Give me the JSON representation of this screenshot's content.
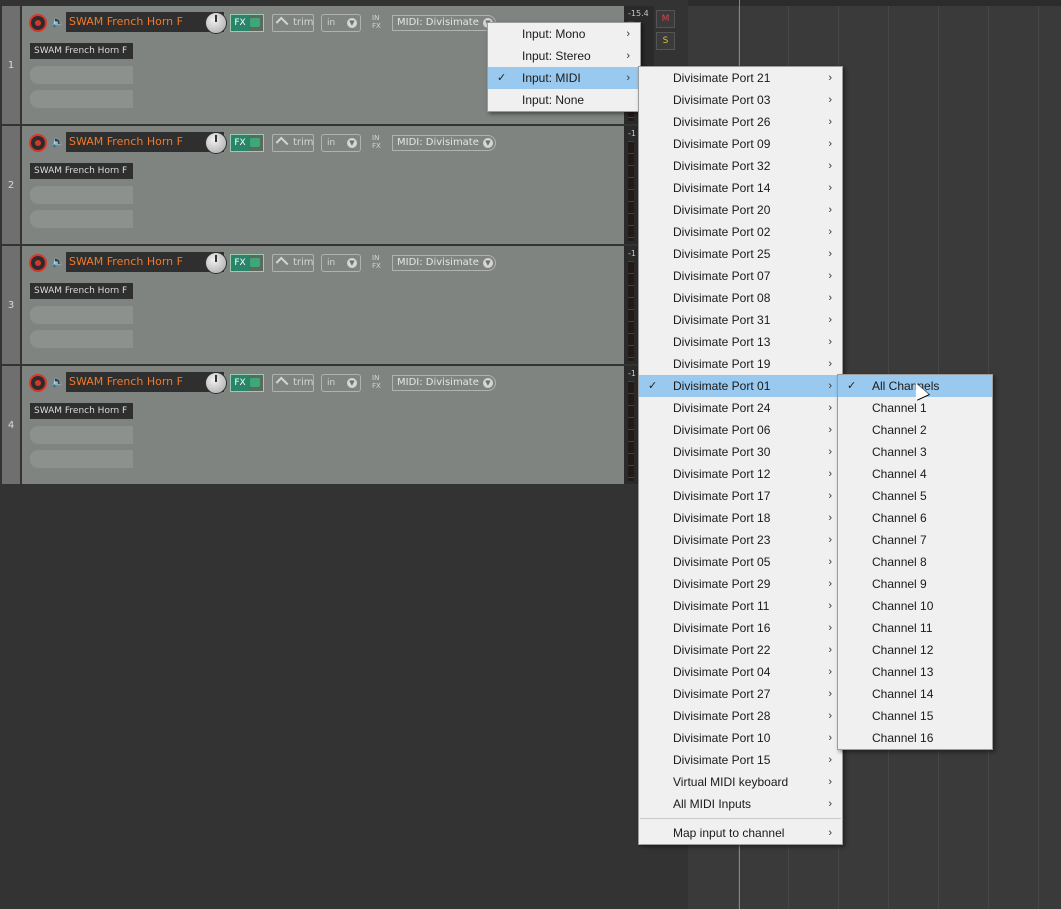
{
  "tracks": [
    {
      "number": "1",
      "name": "SWAM French Horn F",
      "fx": "FX",
      "trim": "trim",
      "input_mode": "in",
      "input_label": "MIDI: Divisimate",
      "item": "SWAM French Horn F",
      "meter": "-15.4"
    },
    {
      "number": "2",
      "name": "SWAM French Horn F",
      "fx": "FX",
      "trim": "trim",
      "input_mode": "in",
      "input_label": "MIDI: Divisimate",
      "item": "SWAM French Horn F",
      "meter": "-1"
    },
    {
      "number": "3",
      "name": "SWAM French Horn F",
      "fx": "FX",
      "trim": "trim",
      "input_mode": "in",
      "input_label": "MIDI: Divisimate",
      "item": "SWAM French Horn F",
      "meter": "-1"
    },
    {
      "number": "4",
      "name": "SWAM French Horn F",
      "fx": "FX",
      "trim": "trim",
      "input_mode": "in",
      "input_label": "MIDI: Divisimate",
      "item": "SWAM French Horn F",
      "meter": "-1"
    }
  ],
  "in_fx": {
    "top": "IN",
    "bottom": "FX"
  },
  "mute": "M",
  "solo": "S",
  "input_menu": [
    {
      "label": "Input: Mono",
      "checked": false,
      "submenu": true
    },
    {
      "label": "Input: Stereo",
      "checked": false,
      "submenu": true
    },
    {
      "label": "Input: MIDI",
      "checked": true,
      "submenu": true
    },
    {
      "label": "Input: None",
      "checked": false,
      "submenu": false
    }
  ],
  "midi_menu": [
    {
      "label": "Divisimate Port 21"
    },
    {
      "label": "Divisimate Port 03"
    },
    {
      "label": "Divisimate Port 26"
    },
    {
      "label": "Divisimate Port 09"
    },
    {
      "label": "Divisimate Port 32"
    },
    {
      "label": "Divisimate Port 14"
    },
    {
      "label": "Divisimate Port 20"
    },
    {
      "label": "Divisimate Port 02"
    },
    {
      "label": "Divisimate Port 25"
    },
    {
      "label": "Divisimate Port 07"
    },
    {
      "label": "Divisimate Port 08"
    },
    {
      "label": "Divisimate Port 31"
    },
    {
      "label": "Divisimate Port 13"
    },
    {
      "label": "Divisimate Port 19"
    },
    {
      "label": "Divisimate Port 01",
      "checked": true
    },
    {
      "label": "Divisimate Port 24"
    },
    {
      "label": "Divisimate Port 06"
    },
    {
      "label": "Divisimate Port 30"
    },
    {
      "label": "Divisimate Port 12"
    },
    {
      "label": "Divisimate Port 17"
    },
    {
      "label": "Divisimate Port 18"
    },
    {
      "label": "Divisimate Port 23"
    },
    {
      "label": "Divisimate Port 05"
    },
    {
      "label": "Divisimate Port 29"
    },
    {
      "label": "Divisimate Port 11"
    },
    {
      "label": "Divisimate Port 16"
    },
    {
      "label": "Divisimate Port 22"
    },
    {
      "label": "Divisimate Port 04"
    },
    {
      "label": "Divisimate Port 27"
    },
    {
      "label": "Divisimate Port 28"
    },
    {
      "label": "Divisimate Port 10"
    },
    {
      "label": "Divisimate Port 15"
    },
    {
      "label": "Virtual MIDI keyboard"
    },
    {
      "label": "All MIDI Inputs"
    }
  ],
  "map_input_label": "Map input to channel",
  "channel_menu": [
    {
      "label": "All Channels",
      "checked": true
    },
    {
      "label": "Channel 1"
    },
    {
      "label": "Channel 2"
    },
    {
      "label": "Channel 3"
    },
    {
      "label": "Channel 4"
    },
    {
      "label": "Channel 5"
    },
    {
      "label": "Channel 6"
    },
    {
      "label": "Channel 7"
    },
    {
      "label": "Channel 8"
    },
    {
      "label": "Channel 9"
    },
    {
      "label": "Channel 10"
    },
    {
      "label": "Channel 11"
    },
    {
      "label": "Channel 12"
    },
    {
      "label": "Channel 13"
    },
    {
      "label": "Channel 14"
    },
    {
      "label": "Channel 15"
    },
    {
      "label": "Channel 16"
    }
  ],
  "glyphs": {
    "check": "✓",
    "submenu": "›",
    "dropdown": "▼",
    "speaker": "🔈"
  }
}
